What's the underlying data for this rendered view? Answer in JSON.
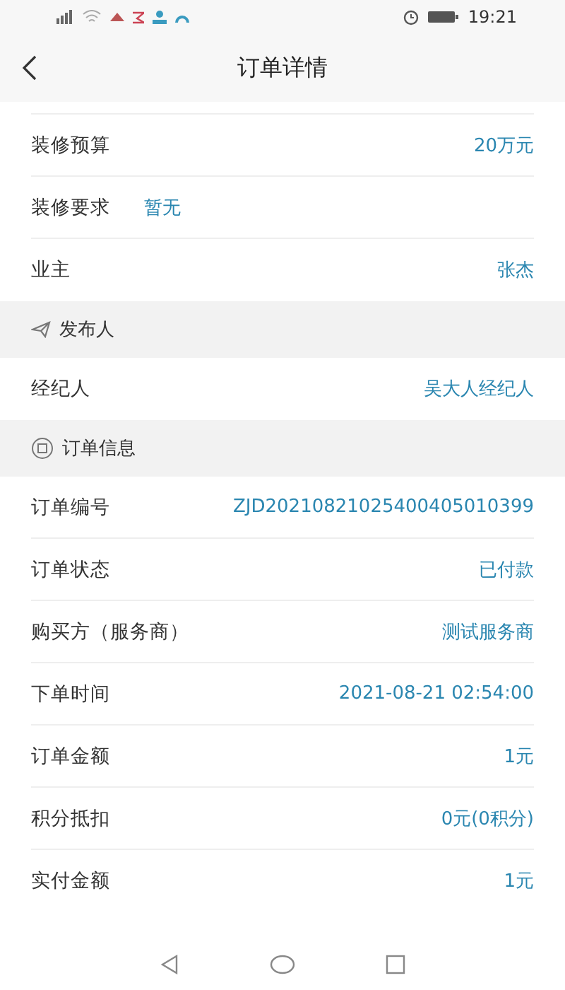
{
  "status_bar": {
    "time": "19:21"
  },
  "header": {
    "title": "订单详情"
  },
  "sections": [
    {
      "kind": "plain",
      "rows": [
        {
          "label": "装修预算",
          "value": "20万元",
          "kind": "right"
        },
        {
          "label": "装修要求",
          "value": "暂无",
          "kind": "inline"
        },
        {
          "label": "业主",
          "value": "张杰",
          "kind": "right"
        }
      ]
    },
    {
      "title": "发布人",
      "kind": "sender",
      "rows": [
        {
          "label": "经纪人",
          "value": "吴大人经纪人",
          "kind": "right"
        }
      ]
    },
    {
      "title": "订单信息",
      "kind": "order",
      "rows": [
        {
          "label": "订单编号",
          "value": "ZJD20210821025400405010399",
          "kind": "right"
        },
        {
          "label": "订单状态",
          "value": "已付款",
          "kind": "right"
        },
        {
          "label": "购买方（服务商）",
          "value": "测试服务商",
          "kind": "right"
        },
        {
          "label": "下单时间",
          "value": "2021-08-21 02:54:00",
          "kind": "right"
        },
        {
          "label": "订单金额",
          "value": "1元",
          "kind": "right"
        },
        {
          "label": "积分抵扣",
          "value": "0元(0积分)",
          "kind": "right"
        },
        {
          "label": "实付金额",
          "value": "1元",
          "kind": "right"
        }
      ]
    }
  ]
}
